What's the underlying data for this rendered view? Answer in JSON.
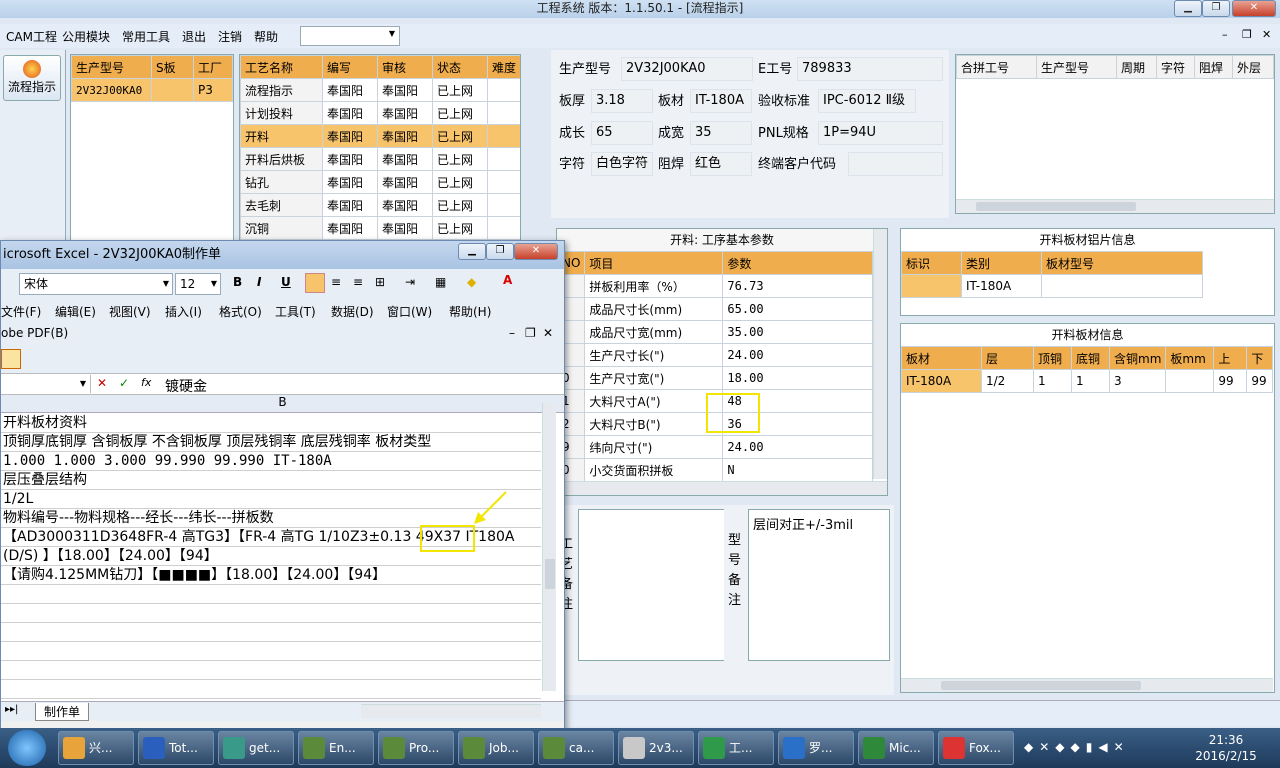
{
  "window": {
    "title": "工程系统  版本：1.1.50.1 - [流程指示]"
  },
  "menu": [
    "CAM工程",
    "公用模块",
    "常用工具",
    "退出",
    "注销",
    "帮助"
  ],
  "left_button": {
    "label": "流程指示"
  },
  "product_table": {
    "headers": [
      "生产型号",
      "S板",
      "工厂"
    ],
    "rows": [
      [
        "2V32J00KA0",
        "",
        "P3"
      ]
    ]
  },
  "process_table": {
    "headers": [
      "工艺名称",
      "编写",
      "审核",
      "状态",
      "难度"
    ],
    "rows": [
      [
        "流程指示",
        "奉国阳",
        "奉国阳",
        "已上网",
        ""
      ],
      [
        "计划投料",
        "奉国阳",
        "奉国阳",
        "已上网",
        ""
      ],
      [
        "开料",
        "奉国阳",
        "奉国阳",
        "已上网",
        ""
      ],
      [
        "开料后烘板",
        "奉国阳",
        "奉国阳",
        "已上网",
        ""
      ],
      [
        "钻孔",
        "奉国阳",
        "奉国阳",
        "已上网",
        ""
      ],
      [
        "去毛刺",
        "奉国阳",
        "奉国阳",
        "已上网",
        ""
      ],
      [
        "沉铜",
        "奉国阳",
        "奉国阳",
        "已上网",
        ""
      ]
    ]
  },
  "info": {
    "model_label": "生产型号",
    "model": "2V32J00KA0",
    "eno_label": "E工号",
    "eno": "789833",
    "thick_label": "板厚",
    "thick": "3.18",
    "material_label": "板材",
    "material": "IT-180A",
    "std_label": "验收标准",
    "std": "IPC-6012 Ⅱ级",
    "len_label": "成长",
    "len": "65",
    "wid_label": "成宽",
    "wid": "35",
    "pnl_label": "PNL规格",
    "pnl": "1P=94U",
    "char_label": "字符",
    "char": "白色字符",
    "mask_label": "阻焊",
    "mask": "红色",
    "cust_label": "终端客户代码",
    "cust": ""
  },
  "combine_table": {
    "headers": [
      "合拼工号",
      "生产型号",
      "周期",
      "字符",
      "阻焊",
      "外层"
    ]
  },
  "params": {
    "title": "开料: 工序基本参数",
    "headers": [
      "NO",
      "项目",
      "参数"
    ],
    "rows": [
      [
        "",
        "拼板利用率（%）",
        "76.73"
      ],
      [
        "",
        "成品尺寸长(mm)",
        "65.00"
      ],
      [
        "",
        "成品尺寸宽(mm)",
        "35.00"
      ],
      [
        "",
        "生产尺寸长(\")",
        "24.00"
      ],
      [
        "0",
        "生产尺寸宽(\")",
        "18.00"
      ],
      [
        "1",
        "大料尺寸A(\")",
        "48"
      ],
      [
        "2",
        "大料尺寸B(\")",
        "36"
      ],
      [
        "9",
        "纬向尺寸(\")",
        "24.00"
      ],
      [
        "0",
        "小交货面积拼板",
        "N"
      ]
    ]
  },
  "board_pic": {
    "title": "开料板材铝片信息",
    "headers": [
      "标识",
      "类别",
      "板材型号"
    ],
    "rows": [
      [
        "",
        "IT-180A",
        ""
      ]
    ]
  },
  "board_info": {
    "title": "开料板材信息",
    "headers": [
      "板材",
      "层",
      "顶铜",
      "底铜",
      "含铜mm",
      "板mm",
      "上",
      "下"
    ],
    "rows": [
      [
        "IT-180A",
        "1/2",
        "1",
        "1",
        "3",
        "",
        "99",
        "99"
      ]
    ]
  },
  "notes": {
    "left_label": "工\n艺\n备\n注",
    "right_label": "型\n号\n备\n注",
    "right_text": "层间对正+/-3mil"
  },
  "excel": {
    "title": "icrosoft Excel - 2V32J00KA0制作单",
    "font": "宋体",
    "size": "12",
    "menu": [
      "文件(F)",
      "编辑(E)",
      "视图(V)",
      "插入(I)",
      "格式(O)",
      "工具(T)",
      "数据(D)",
      "窗口(W)",
      "帮助(H)"
    ],
    "pdf_menu": "obe PDF(B)",
    "formula": "镀硬金",
    "column": "B",
    "rows": [
      "开料板材资料",
      "顶铜厚底铜厚 含铜板厚 不含铜板厚 顶层残铜率 底层残铜率 板材类型",
      "1.000  1.000    3.000            99.990    99.990     IT-180A",
      "层压叠层结构",
      "1/2L",
      "物料编号---物料规格---经长---纬长---拼板数",
      "【AD3000311D3648FR-4 高TG3】【FR-4 高TG 1/10Z3±0.13 49X37  IT180A",
      "(D/S) 】【18.00】【24.00】【94】",
      "【请购4.125MM钻刀】【■■■■】【18.00】【24.00】【94】"
    ],
    "sheet_tab": "制作单"
  },
  "taskbar": {
    "items": [
      "兴...",
      "Tot...",
      "get...",
      "En...",
      "Pro...",
      "Job...",
      "ca...",
      "2v3...",
      "工...",
      "罗...",
      "Mic...",
      "Fox..."
    ],
    "time": "21:36",
    "date": "2016/2/15"
  }
}
